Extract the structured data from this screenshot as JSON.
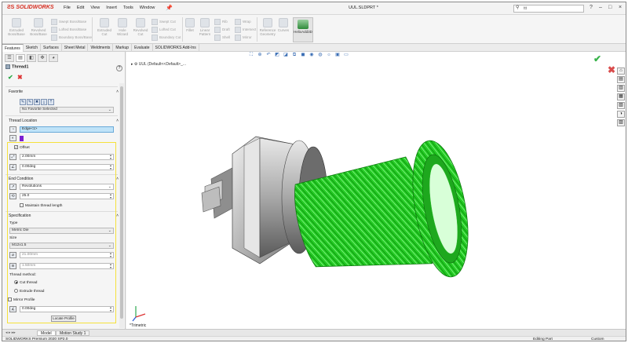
{
  "app": {
    "brand": "SOLIDWORKS",
    "doc_title": "UUL.SLDPRT *",
    "menu": [
      "File",
      "Edit",
      "View",
      "Insert",
      "Tools",
      "Window"
    ],
    "search_value": "ttt",
    "window_controls": [
      "?",
      "–",
      "□",
      "×"
    ]
  },
  "commands": {
    "extruded_boss": "Extruded Boss/Base",
    "revolved_boss": "Revolved Boss/Base",
    "swept_boss": "Swept Boss/Base",
    "lofted_boss": "Lofted Boss/Base",
    "boundary_boss": "Boundary Boss/Base",
    "extruded_cut": "Extruded Cut",
    "hole_wizard": "Hole Wizard",
    "revolved_cut": "Revolved Cut",
    "swept_cut": "Swept Cut",
    "lofted_cut": "Lofted Cut",
    "boundary_cut": "Boundary Cut",
    "fillet": "Fillet",
    "linear_pattern": "Linear Pattern",
    "rib": "Rib",
    "draft": "Draft",
    "shell": "Shell",
    "wrap": "Wrap",
    "intersect": "Intersect",
    "mirror": "Mirror",
    "reference_geometry": "Reference Geometry",
    "curves": "Curves",
    "helixadd": "HelixAdd3D"
  },
  "tabs": [
    "Features",
    "Sketch",
    "Surfaces",
    "Sheet Metal",
    "Weldments",
    "Markup",
    "Evaluate",
    "SOLIDWORKS Add-Ins"
  ],
  "property_manager": {
    "title": "Thread1",
    "help": "?",
    "favorite": {
      "heading": "Favorite",
      "selected": "No Favorite Selected"
    },
    "thread_location": {
      "heading": "Thread Location",
      "edge": "Edge<1>",
      "offset_label": "Offset",
      "offset_distance": "2.00mm",
      "offset_angle": "0.00deg"
    },
    "end_condition": {
      "heading": "End Condition",
      "type": "Revolutions",
      "revolutions": "25.0",
      "maintain_label": "Maintain thread length"
    },
    "specification": {
      "heading": "Specification",
      "type_label": "Type",
      "type_value": "Metric Die",
      "size_label": "Size",
      "size_value": "M12x1.5",
      "diameter": "21.00mm",
      "pitch": "1.50mm",
      "method_label": "Thread method:",
      "cut_thread": "Cut thread",
      "extrude_thread": "Extrude thread",
      "mirror_profile": "Mirror Profile",
      "rotation": "0.00deg",
      "locate_button": "Locate Profile"
    }
  },
  "viewport": {
    "breadcrumb": "UUL (Default<<Default>_...",
    "view_label": "*Trimetric"
  },
  "bottom_tabs": [
    "Model",
    "Motion Study 1"
  ],
  "status": {
    "version": "SOLIDWORKS Premium 2020 SP2.0",
    "mode": "Editing Part",
    "custom": "Custom"
  },
  "colors": {
    "thread_green": "#28e028",
    "selection_yellow": "#f5e13b",
    "brand_red": "#d52b1e"
  }
}
